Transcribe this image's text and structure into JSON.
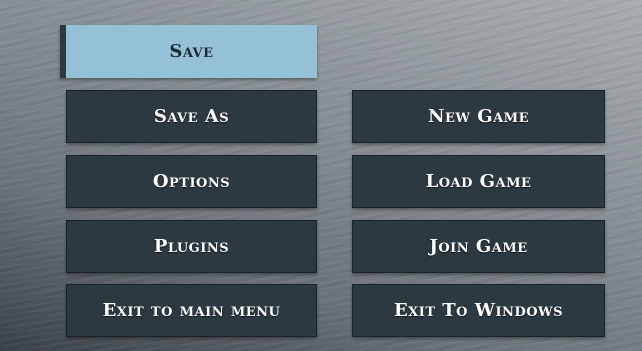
{
  "menu": {
    "save_label": "Save",
    "save_as_label": "Save As",
    "options_label": "Options",
    "plugins_label": "Plugins",
    "exit_main_label": "Exit to main menu",
    "new_game_label": "New Game",
    "load_game_label": "Load Game",
    "join_game_label": "Join Game",
    "exit_windows_label": "Exit To Windows"
  },
  "colors": {
    "button_bg": "#2c3940",
    "button_selected_bg": "#94c1d6",
    "button_text": "#ffffff",
    "selected_text": "#1c2a32"
  }
}
